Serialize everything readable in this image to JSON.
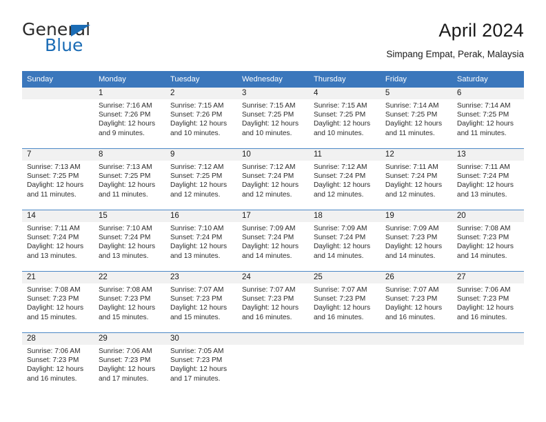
{
  "brand": {
    "name_part1": "General",
    "name_part2": "Blue",
    "flag_icon": "blue-triangle-flag"
  },
  "header": {
    "title": "April 2024",
    "subtitle": "Simpang Empat, Perak, Malaysia"
  },
  "colors": {
    "header_blue": "#3b77bc",
    "row_divider_blue": "#4a86c5",
    "daynum_band_gray": "#f1f1f1",
    "brand_blue": "#1b6cb5",
    "text": "#1a1a1a"
  },
  "weekday_headers": [
    "Sunday",
    "Monday",
    "Tuesday",
    "Wednesday",
    "Thursday",
    "Friday",
    "Saturday"
  ],
  "labels": {
    "sunrise_prefix": "Sunrise: ",
    "sunset_prefix": "Sunset: ",
    "daylight_prefix": "Daylight: "
  },
  "weeks": [
    [
      {
        "day": "",
        "sunrise": "",
        "sunset": "",
        "daylight_line1": "",
        "daylight_line2": "",
        "empty": true
      },
      {
        "day": "1",
        "sunrise": "Sunrise: 7:16 AM",
        "sunset": "Sunset: 7:26 PM",
        "daylight_line1": "Daylight: 12 hours",
        "daylight_line2": "and 9 minutes.",
        "empty": false
      },
      {
        "day": "2",
        "sunrise": "Sunrise: 7:15 AM",
        "sunset": "Sunset: 7:26 PM",
        "daylight_line1": "Daylight: 12 hours",
        "daylight_line2": "and 10 minutes.",
        "empty": false
      },
      {
        "day": "3",
        "sunrise": "Sunrise: 7:15 AM",
        "sunset": "Sunset: 7:25 PM",
        "daylight_line1": "Daylight: 12 hours",
        "daylight_line2": "and 10 minutes.",
        "empty": false
      },
      {
        "day": "4",
        "sunrise": "Sunrise: 7:15 AM",
        "sunset": "Sunset: 7:25 PM",
        "daylight_line1": "Daylight: 12 hours",
        "daylight_line2": "and 10 minutes.",
        "empty": false
      },
      {
        "day": "5",
        "sunrise": "Sunrise: 7:14 AM",
        "sunset": "Sunset: 7:25 PM",
        "daylight_line1": "Daylight: 12 hours",
        "daylight_line2": "and 11 minutes.",
        "empty": false
      },
      {
        "day": "6",
        "sunrise": "Sunrise: 7:14 AM",
        "sunset": "Sunset: 7:25 PM",
        "daylight_line1": "Daylight: 12 hours",
        "daylight_line2": "and 11 minutes.",
        "empty": false
      }
    ],
    [
      {
        "day": "7",
        "sunrise": "Sunrise: 7:13 AM",
        "sunset": "Sunset: 7:25 PM",
        "daylight_line1": "Daylight: 12 hours",
        "daylight_line2": "and 11 minutes.",
        "empty": false
      },
      {
        "day": "8",
        "sunrise": "Sunrise: 7:13 AM",
        "sunset": "Sunset: 7:25 PM",
        "daylight_line1": "Daylight: 12 hours",
        "daylight_line2": "and 11 minutes.",
        "empty": false
      },
      {
        "day": "9",
        "sunrise": "Sunrise: 7:12 AM",
        "sunset": "Sunset: 7:25 PM",
        "daylight_line1": "Daylight: 12 hours",
        "daylight_line2": "and 12 minutes.",
        "empty": false
      },
      {
        "day": "10",
        "sunrise": "Sunrise: 7:12 AM",
        "sunset": "Sunset: 7:24 PM",
        "daylight_line1": "Daylight: 12 hours",
        "daylight_line2": "and 12 minutes.",
        "empty": false
      },
      {
        "day": "11",
        "sunrise": "Sunrise: 7:12 AM",
        "sunset": "Sunset: 7:24 PM",
        "daylight_line1": "Daylight: 12 hours",
        "daylight_line2": "and 12 minutes.",
        "empty": false
      },
      {
        "day": "12",
        "sunrise": "Sunrise: 7:11 AM",
        "sunset": "Sunset: 7:24 PM",
        "daylight_line1": "Daylight: 12 hours",
        "daylight_line2": "and 12 minutes.",
        "empty": false
      },
      {
        "day": "13",
        "sunrise": "Sunrise: 7:11 AM",
        "sunset": "Sunset: 7:24 PM",
        "daylight_line1": "Daylight: 12 hours",
        "daylight_line2": "and 13 minutes.",
        "empty": false
      }
    ],
    [
      {
        "day": "14",
        "sunrise": "Sunrise: 7:11 AM",
        "sunset": "Sunset: 7:24 PM",
        "daylight_line1": "Daylight: 12 hours",
        "daylight_line2": "and 13 minutes.",
        "empty": false
      },
      {
        "day": "15",
        "sunrise": "Sunrise: 7:10 AM",
        "sunset": "Sunset: 7:24 PM",
        "daylight_line1": "Daylight: 12 hours",
        "daylight_line2": "and 13 minutes.",
        "empty": false
      },
      {
        "day": "16",
        "sunrise": "Sunrise: 7:10 AM",
        "sunset": "Sunset: 7:24 PM",
        "daylight_line1": "Daylight: 12 hours",
        "daylight_line2": "and 13 minutes.",
        "empty": false
      },
      {
        "day": "17",
        "sunrise": "Sunrise: 7:09 AM",
        "sunset": "Sunset: 7:24 PM",
        "daylight_line1": "Daylight: 12 hours",
        "daylight_line2": "and 14 minutes.",
        "empty": false
      },
      {
        "day": "18",
        "sunrise": "Sunrise: 7:09 AM",
        "sunset": "Sunset: 7:24 PM",
        "daylight_line1": "Daylight: 12 hours",
        "daylight_line2": "and 14 minutes.",
        "empty": false
      },
      {
        "day": "19",
        "sunrise": "Sunrise: 7:09 AM",
        "sunset": "Sunset: 7:23 PM",
        "daylight_line1": "Daylight: 12 hours",
        "daylight_line2": "and 14 minutes.",
        "empty": false
      },
      {
        "day": "20",
        "sunrise": "Sunrise: 7:08 AM",
        "sunset": "Sunset: 7:23 PM",
        "daylight_line1": "Daylight: 12 hours",
        "daylight_line2": "and 14 minutes.",
        "empty": false
      }
    ],
    [
      {
        "day": "21",
        "sunrise": "Sunrise: 7:08 AM",
        "sunset": "Sunset: 7:23 PM",
        "daylight_line1": "Daylight: 12 hours",
        "daylight_line2": "and 15 minutes.",
        "empty": false
      },
      {
        "day": "22",
        "sunrise": "Sunrise: 7:08 AM",
        "sunset": "Sunset: 7:23 PM",
        "daylight_line1": "Daylight: 12 hours",
        "daylight_line2": "and 15 minutes.",
        "empty": false
      },
      {
        "day": "23",
        "sunrise": "Sunrise: 7:07 AM",
        "sunset": "Sunset: 7:23 PM",
        "daylight_line1": "Daylight: 12 hours",
        "daylight_line2": "and 15 minutes.",
        "empty": false
      },
      {
        "day": "24",
        "sunrise": "Sunrise: 7:07 AM",
        "sunset": "Sunset: 7:23 PM",
        "daylight_line1": "Daylight: 12 hours",
        "daylight_line2": "and 16 minutes.",
        "empty": false
      },
      {
        "day": "25",
        "sunrise": "Sunrise: 7:07 AM",
        "sunset": "Sunset: 7:23 PM",
        "daylight_line1": "Daylight: 12 hours",
        "daylight_line2": "and 16 minutes.",
        "empty": false
      },
      {
        "day": "26",
        "sunrise": "Sunrise: 7:07 AM",
        "sunset": "Sunset: 7:23 PM",
        "daylight_line1": "Daylight: 12 hours",
        "daylight_line2": "and 16 minutes.",
        "empty": false
      },
      {
        "day": "27",
        "sunrise": "Sunrise: 7:06 AM",
        "sunset": "Sunset: 7:23 PM",
        "daylight_line1": "Daylight: 12 hours",
        "daylight_line2": "and 16 minutes.",
        "empty": false
      }
    ],
    [
      {
        "day": "28",
        "sunrise": "Sunrise: 7:06 AM",
        "sunset": "Sunset: 7:23 PM",
        "daylight_line1": "Daylight: 12 hours",
        "daylight_line2": "and 16 minutes.",
        "empty": false
      },
      {
        "day": "29",
        "sunrise": "Sunrise: 7:06 AM",
        "sunset": "Sunset: 7:23 PM",
        "daylight_line1": "Daylight: 12 hours",
        "daylight_line2": "and 17 minutes.",
        "empty": false
      },
      {
        "day": "30",
        "sunrise": "Sunrise: 7:05 AM",
        "sunset": "Sunset: 7:23 PM",
        "daylight_line1": "Daylight: 12 hours",
        "daylight_line2": "and 17 minutes.",
        "empty": false
      },
      {
        "day": "",
        "sunrise": "",
        "sunset": "",
        "daylight_line1": "",
        "daylight_line2": "",
        "empty": true
      },
      {
        "day": "",
        "sunrise": "",
        "sunset": "",
        "daylight_line1": "",
        "daylight_line2": "",
        "empty": true
      },
      {
        "day": "",
        "sunrise": "",
        "sunset": "",
        "daylight_line1": "",
        "daylight_line2": "",
        "empty": true
      },
      {
        "day": "",
        "sunrise": "",
        "sunset": "",
        "daylight_line1": "",
        "daylight_line2": "",
        "empty": true
      }
    ]
  ]
}
